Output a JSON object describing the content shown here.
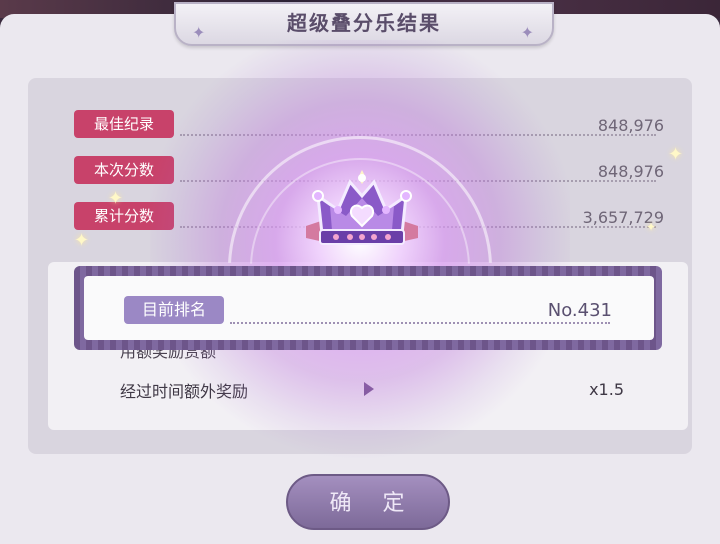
{
  "title": "超级叠分乐结果",
  "stats": [
    {
      "label": "最佳纪录",
      "value": "848,976"
    },
    {
      "label": "本次分数",
      "value": "848,976"
    },
    {
      "label": "累计分数",
      "value": "3,657,729"
    }
  ],
  "rank": {
    "label": "目前排名",
    "value": "No.431"
  },
  "bonus": {
    "label": "经过时间额外奖励",
    "value": "x1.5",
    "partial_text": "用额奖励赏额"
  },
  "confirm_button": "确 定",
  "icons": {
    "crown": "crown-icon",
    "play": "play-arrow-icon",
    "star": "star-icon"
  },
  "colors": {
    "stat_label_bg": "#c8426a",
    "rank_label_bg": "#9b88c5",
    "button_bg": "#8f7aab"
  }
}
